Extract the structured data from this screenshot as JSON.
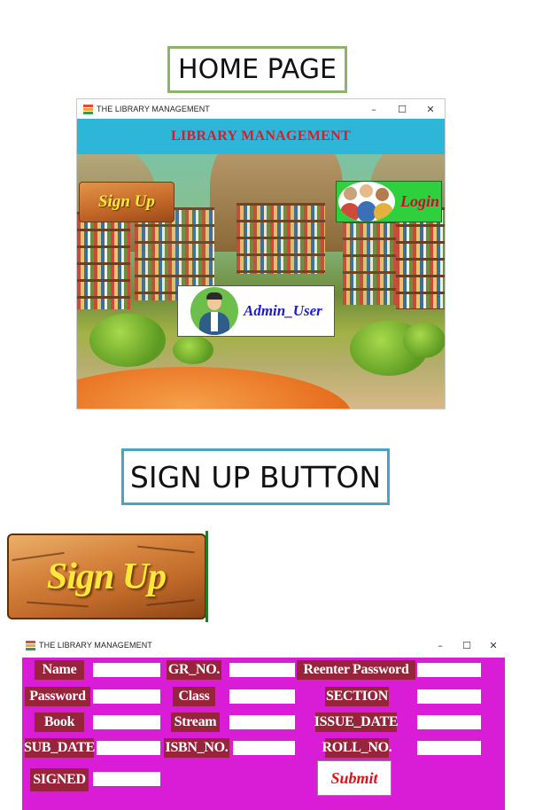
{
  "captions": {
    "home_page": "HOME PAGE",
    "sign_up_button": "SIGN UP BUTTON"
  },
  "home_window": {
    "title": "THE LIBRARY MANAGEMENT",
    "controls": {
      "minimize": "–",
      "maximize": "☐",
      "close": "✕"
    },
    "banner": "LIBRARY MANAGEMENT",
    "buttons": {
      "sign_up": "Sign Up",
      "login": "Login",
      "admin": "Admin_User"
    }
  },
  "zoomed_button": {
    "label": "Sign Up"
  },
  "signup_window": {
    "title": "THE LIBRARY MANAGEMENT",
    "controls": {
      "minimize": "–",
      "maximize": "☐",
      "close": "✕"
    },
    "labels": {
      "name": "Name",
      "password": "Password",
      "book": "Book",
      "sub_date": "SUB_DATE",
      "signed": "SIGNED",
      "gr_no": "GR_NO.",
      "class": "Class",
      "stream": "Stream",
      "isbn_no": "ISBN_NO.",
      "reenter_password": "Reenter Password",
      "section": "SECTION",
      "issue_date": "ISSUE_DATE",
      "roll_no": "ROLL_NO."
    },
    "fields": {
      "name": "",
      "password": "",
      "book": "",
      "sub_date": "",
      "signed": "",
      "gr_no": "",
      "class": "",
      "stream": "",
      "isbn_no": "",
      "reenter_password": "",
      "section": "",
      "issue_date": "",
      "roll_no": ""
    },
    "submit": "Submit"
  },
  "colors": {
    "banner_bg": "#2eb6d8",
    "banner_text": "#d21f2e",
    "form_bg": "#d91cd6",
    "label_bg": "#97243a",
    "submit_text": "#e0101a",
    "caption1_border": "#8eb36b",
    "caption2_border": "#4aa3c7"
  }
}
